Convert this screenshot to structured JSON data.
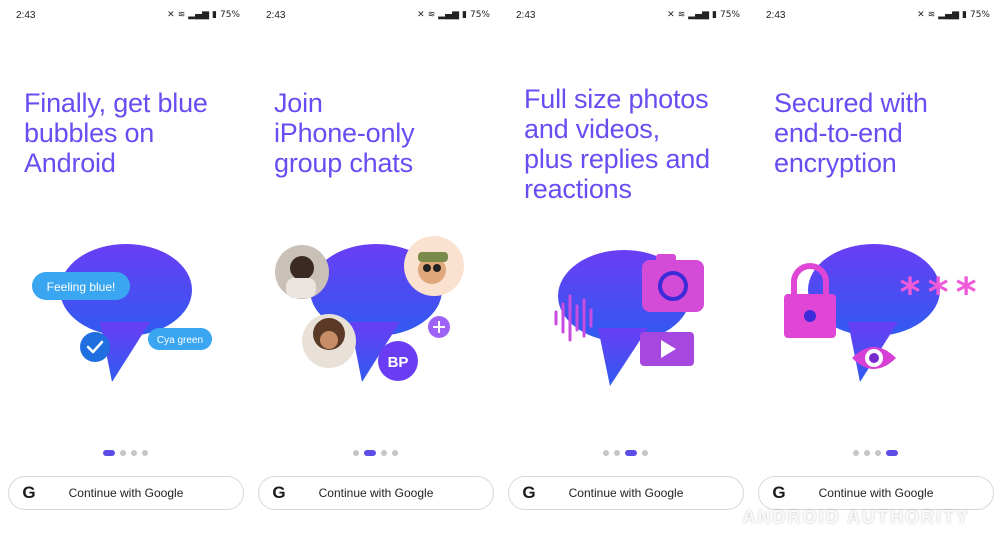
{
  "status_bar": {
    "time": "2:43",
    "battery": "75%"
  },
  "screens": [
    {
      "headline": [
        "Finally, get blue",
        "bubbles on",
        "Android"
      ],
      "bubble_left": "Feeling blue!",
      "bubble_right": "Cya green",
      "active_dot": 0
    },
    {
      "headline": [
        "Join",
        "iPhone-only",
        "group chats"
      ],
      "badge_text": "BP",
      "active_dot": 1
    },
    {
      "headline": [
        "Full size photos",
        "and videos,",
        "plus replies and",
        "reactions"
      ],
      "active_dot": 2
    },
    {
      "headline": [
        "Secured with",
        "end-to-end",
        "encryption"
      ],
      "password_text": "***",
      "active_dot": 3
    }
  ],
  "google_button": {
    "label": "Continue with Google",
    "icon": "google-g-icon",
    "glyph": "G"
  },
  "watermark": "ANDROID AUTHORITY",
  "colors": {
    "headline": "#6a4cf3",
    "bubble_gradient_top": "#6a3df5",
    "bubble_gradient_bottom": "#2f5bf0",
    "dot_active": "#5b4de6",
    "magenta": "#e040d8"
  }
}
